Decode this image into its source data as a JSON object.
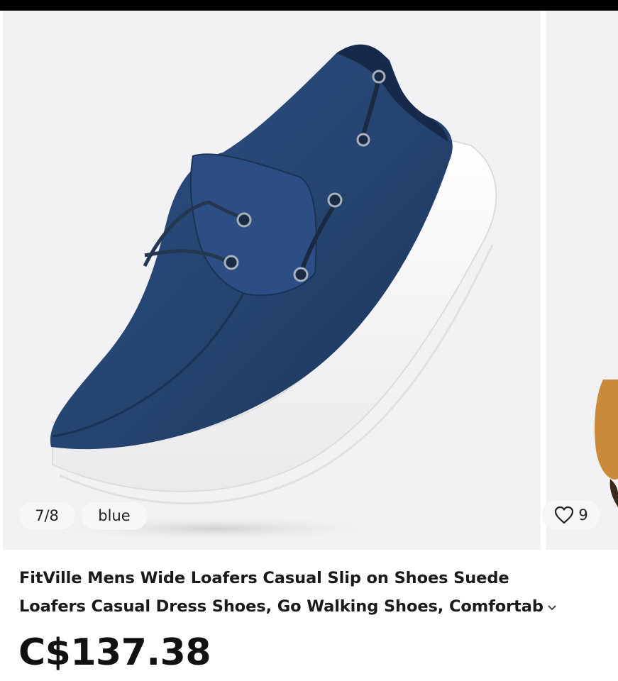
{
  "gallery": {
    "image_counter": "7/8",
    "color_label": "blue",
    "favorites_count": "9"
  },
  "product": {
    "title_line1": "FitVille Mens Wide Loafers Casual Slip on Shoes Suede",
    "title_line2": "Loafers Casual Dress Shoes, Go Walking Shoes, Comfortab",
    "price": "C$137.38"
  },
  "icons": {
    "favorite": "heart-outline-icon",
    "expand": "chevron-down-icon"
  },
  "colors": {
    "shoe_upper": "#24426d",
    "sole": "#ffffff",
    "image_bg": "#f2f2f4",
    "next_shoe": "#c98a3c"
  }
}
